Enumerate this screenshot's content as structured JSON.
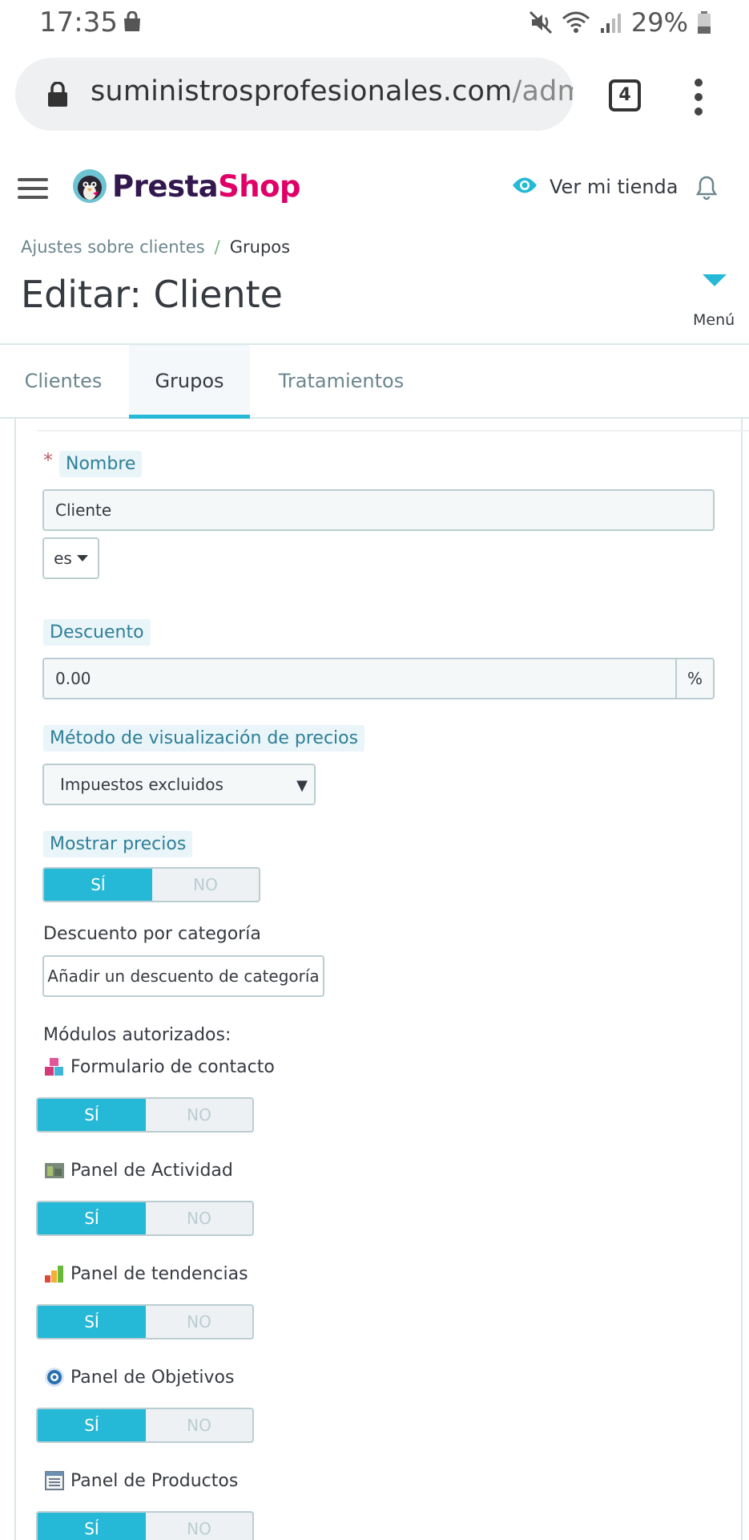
{
  "status_bar": {
    "time": "17:35",
    "battery_percent": "29%",
    "icons": [
      "shopping-bag-icon",
      "mute-icon",
      "wifi-icon",
      "signal-icon",
      "battery-icon"
    ]
  },
  "browser": {
    "url_main": "suministrosprofesionales.com",
    "url_rest": "/adm",
    "tab_count": "4"
  },
  "header": {
    "logo_presta": "Presta",
    "logo_shop": "Shop",
    "view_store": "Ver mi tienda"
  },
  "breadcrumb": {
    "parent": "Ajustes sobre clientes",
    "separator": "/",
    "current": "Grupos"
  },
  "page": {
    "title": "Editar: Cliente",
    "menu_label": "Menú"
  },
  "tabs": [
    {
      "label": "Clientes",
      "active": false
    },
    {
      "label": "Grupos",
      "active": true
    },
    {
      "label": "Tratamientos",
      "active": false
    }
  ],
  "form": {
    "required_mark": "*",
    "name_label": "Nombre",
    "name_value": "Cliente",
    "language": "es",
    "discount_label": "Descuento",
    "discount_value": "0.00",
    "discount_unit": "%",
    "price_display_label": "Método de visualización de precios",
    "price_display_value": "Impuestos excluidos",
    "show_prices_label": "Mostrar precios",
    "show_prices": {
      "on": "SÍ",
      "off": "NO",
      "selected": "SÍ"
    },
    "category_discount_label": "Descuento por categoría",
    "category_discount_button": "Añadir un descuento de categoría",
    "modules_label": "Módulos autorizados:"
  },
  "modules": [
    {
      "name": "Formulario de contacto",
      "icon": "contact-form-icon",
      "on": "SÍ",
      "off": "NO",
      "selected": "SÍ"
    },
    {
      "name": "Panel de Actividad",
      "icon": "activity-panel-icon",
      "on": "SÍ",
      "off": "NO",
      "selected": "SÍ"
    },
    {
      "name": "Panel de tendencias",
      "icon": "trends-panel-icon",
      "on": "SÍ",
      "off": "NO",
      "selected": "SÍ"
    },
    {
      "name": "Panel de Objetivos",
      "icon": "goals-panel-icon",
      "on": "SÍ",
      "off": "NO",
      "selected": "SÍ"
    },
    {
      "name": "Panel de Productos",
      "icon": "products-panel-icon",
      "on": "SÍ",
      "off": "NO",
      "selected": "SÍ"
    }
  ],
  "colors": {
    "accent": "#25b9d7",
    "label_bg": "#eaf5f9",
    "label_text": "#2e7f97",
    "logo_dark": "#33184f",
    "logo_pink": "#df0067"
  }
}
